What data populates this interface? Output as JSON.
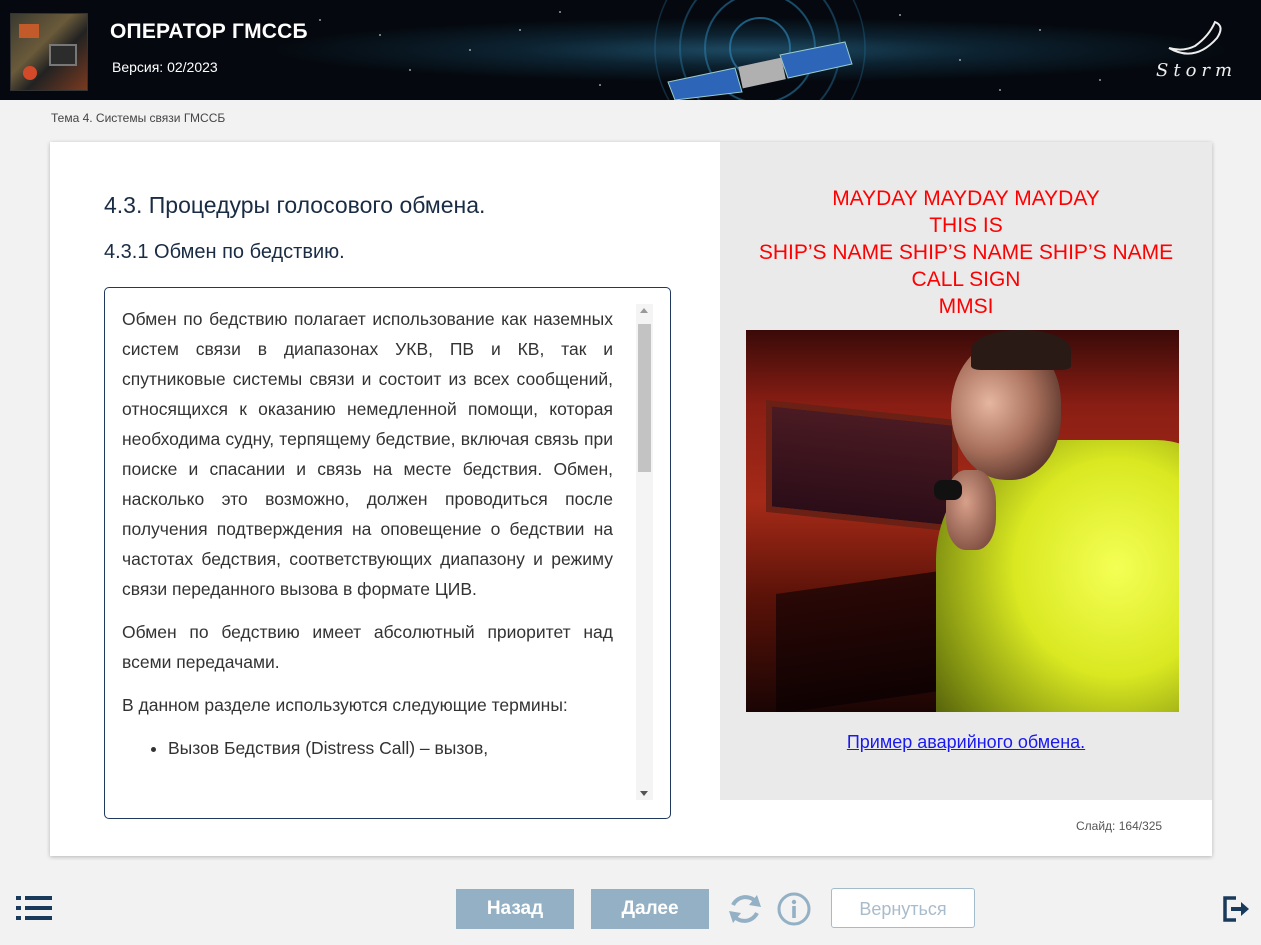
{
  "header": {
    "title": "ОПЕРАТОР ГМССБ",
    "version": "Версия: 02/2023",
    "logo_text": "Storm"
  },
  "breadcrumb": "Тема 4. Системы связи ГМССБ",
  "content": {
    "section_title": "4.3. Процедуры голосового обмена.",
    "subsection_title": "4.3.1 Обмен по бедствию.",
    "paragraphs": [
      "Обмен по бедствию полагает использование как наземных систем связи в диапазонах УКВ, ПВ и КВ, так и спутниковые системы связи и состоит из всех сообщений, относящихся к оказанию немедленной помощи, которая необходима судну, терпящему бедствие, включая связь при поиске и спасании и связь на месте бедствия. Обмен, насколько это возможно, должен проводиться после получения подтверждения на оповещение о бедствии на частотах бедствия, соответствующих диапазону и режиму связи переданного вызова в формате ЦИВ.",
      "Обмен по бедствию имеет абсолютный приоритет над всеми передачами.",
      "В данном разделе используются следующие термины:"
    ],
    "bullets": [
      "Вызов Бедствия (Distress Call) – вызов,"
    ],
    "scroll_position": 0.08
  },
  "right_pane": {
    "mayday_lines": [
      "MAYDAY MAYDAY MAYDAY",
      "THIS IS",
      "SHIP’S NAME SHIP’S NAME SHIP’S NAME",
      "CALL SIGN",
      "MMSI"
    ],
    "example_link": "Пример аварийного обмена.",
    "colors": {
      "mayday_text": "#ff0000",
      "link": "#1a1aee"
    }
  },
  "slide_counter": "Слайд: 164/325",
  "footer": {
    "menu_icon": "menu-list-icon",
    "back_label": "Назад",
    "next_label": "Далее",
    "reload_icon": "reload-icon",
    "info_icon": "info-icon",
    "return_label": "Вернуться",
    "exit_icon": "exit-icon"
  },
  "colors": {
    "nav_button": "#93b0c5",
    "title_text": "#1a2c44",
    "text_box_border": "#1f3a5e"
  }
}
